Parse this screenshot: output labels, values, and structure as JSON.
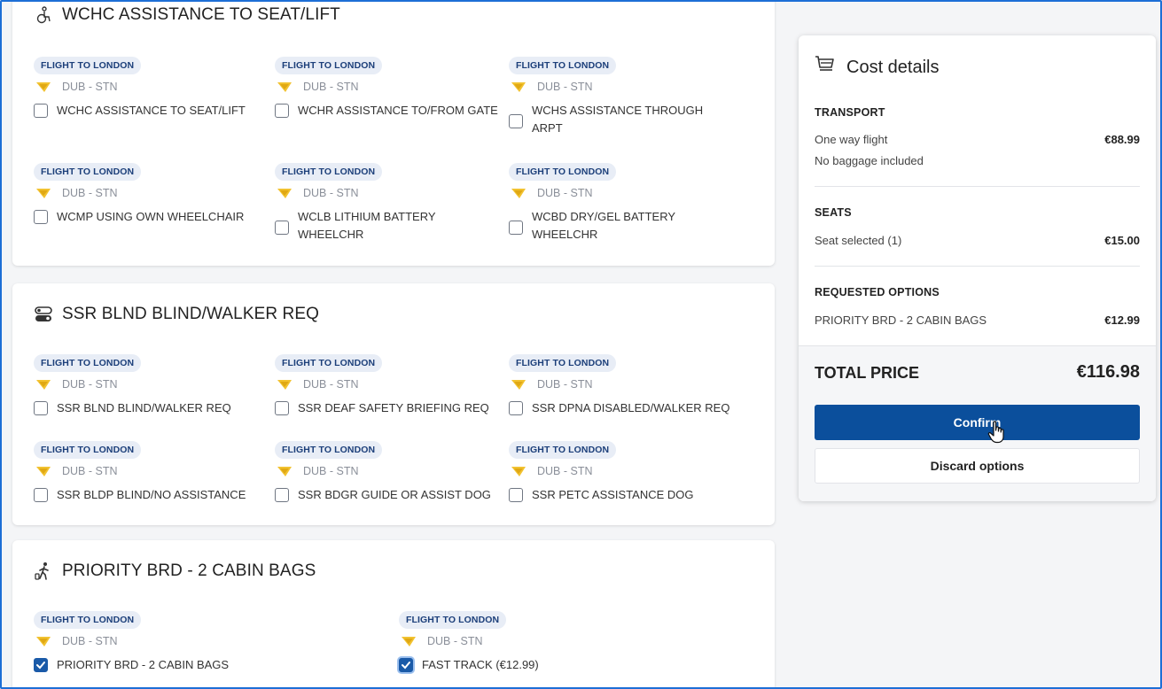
{
  "sections": {
    "wchc": {
      "title": "WCHC ASSISTANCE TO SEAT/LIFT",
      "icon": "wheelchair-icon",
      "options": [
        {
          "badge": "FLIGHT TO LONDON",
          "route": "DUB - STN",
          "label": "WCHC ASSISTANCE TO SEAT/LIFT",
          "checked": false
        },
        {
          "badge": "FLIGHT TO LONDON",
          "route": "DUB - STN",
          "label": "WCHR ASSISTANCE TO/FROM GATE",
          "checked": false
        },
        {
          "badge": "FLIGHT TO LONDON",
          "route": "DUB - STN",
          "label_1": "WCHS ASSISTANCE THROUGH",
          "label_2": "ARPT",
          "checked": false
        },
        {
          "badge": "FLIGHT TO LONDON",
          "route": "DUB - STN",
          "label": "WCMP USING OWN WHEELCHAIR",
          "checked": false
        },
        {
          "badge": "FLIGHT TO LONDON",
          "route": "DUB - STN",
          "label_1": "WCLB LITHIUM BATTERY",
          "label_2": "WHEELCHR",
          "checked": false
        },
        {
          "badge": "FLIGHT TO LONDON",
          "route": "DUB - STN",
          "label_1": "WCBD DRY/GEL BATTERY",
          "label_2": "WHEELCHR",
          "checked": false
        }
      ]
    },
    "blnd": {
      "title": "SSR BLND BLIND/WALKER REQ",
      "icon": "toggle-icon",
      "options": [
        {
          "badge": "FLIGHT TO LONDON",
          "route": "DUB - STN",
          "label": "SSR BLND BLIND/WALKER REQ",
          "checked": false
        },
        {
          "badge": "FLIGHT TO LONDON",
          "route": "DUB - STN",
          "label": "SSR DEAF SAFETY BRIEFING REQ",
          "checked": false
        },
        {
          "badge": "FLIGHT TO LONDON",
          "route": "DUB - STN",
          "label": "SSR DPNA DISABLED/WALKER REQ",
          "checked": false
        },
        {
          "badge": "FLIGHT TO LONDON",
          "route": "DUB - STN",
          "label": "SSR BLDP BLIND/NO ASSISTANCE",
          "checked": false
        },
        {
          "badge": "FLIGHT TO LONDON",
          "route": "DUB - STN",
          "label": "SSR BDGR GUIDE OR ASSIST DOG",
          "checked": false
        },
        {
          "badge": "FLIGHT TO LONDON",
          "route": "DUB - STN",
          "label": "SSR PETC ASSISTANCE DOG",
          "checked": false
        }
      ]
    },
    "priority": {
      "title": "PRIORITY BRD - 2 CABIN BAGS",
      "icon": "walking-luggage-icon",
      "options": [
        {
          "badge": "FLIGHT TO LONDON",
          "route": "DUB - STN",
          "label": "PRIORITY BRD - 2 CABIN BAGS",
          "checked": true
        },
        {
          "badge": "FLIGHT TO LONDON",
          "route": "DUB - STN",
          "label": "FAST TRACK (€12.99)",
          "checked": true
        }
      ]
    }
  },
  "cost": {
    "title": "Cost details",
    "icon": "cart-icon",
    "transport": {
      "heading": "TRANSPORT",
      "line1": "One way flight",
      "line2": "No baggage included",
      "price": "€88.99"
    },
    "seats": {
      "heading": "SEATS",
      "line": "Seat selected (1)",
      "price": "€15.00"
    },
    "requested": {
      "heading": "REQUESTED OPTIONS",
      "line": "PRIORITY BRD - 2 CABIN BAGS",
      "price": "€12.99"
    },
    "total_label": "TOTAL PRICE",
    "total_value": "€116.98",
    "confirm_label": "Confirm",
    "discard_label": "Discard options"
  },
  "colors": {
    "accent": "#0b4f9c",
    "badge_bg": "#e8edf6",
    "frame": "#1d6fd6",
    "plane": "#f2c230"
  }
}
